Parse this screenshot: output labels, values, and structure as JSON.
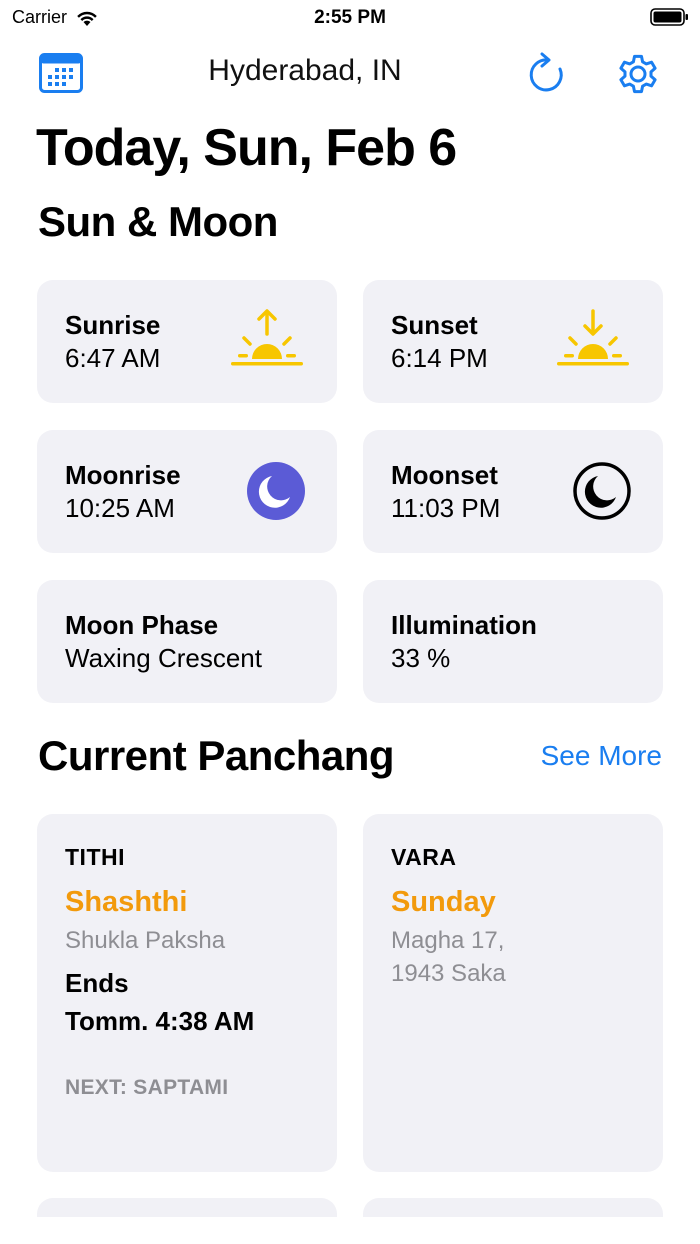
{
  "status_bar": {
    "carrier": "Carrier",
    "time": "2:55 PM"
  },
  "nav": {
    "location": "Hyderabad, IN",
    "calendar_icon": "calendar-icon",
    "refresh_icon": "refresh-icon",
    "settings_icon": "gear-icon",
    "accent_color": "#1a7ef0"
  },
  "header": {
    "title": "Today, Sun, Feb 6"
  },
  "sun_moon": {
    "title": "Sun & Moon",
    "cards": [
      {
        "label": "Sunrise",
        "value": "6:47 AM",
        "icon": "sunrise-icon"
      },
      {
        "label": "Sunset",
        "value": "6:14 PM",
        "icon": "sunset-icon"
      },
      {
        "label": "Moonrise",
        "value": "10:25 AM",
        "icon": "moonrise-icon"
      },
      {
        "label": "Moonset",
        "value": "11:03 PM",
        "icon": "moonset-icon"
      },
      {
        "label": "Moon Phase",
        "value": "Waxing Crescent"
      },
      {
        "label": "Illumination",
        "value": "33 %"
      }
    ]
  },
  "panchang": {
    "title": "Current Panchang",
    "see_more": "See More",
    "highlight_color": "#f29a0c",
    "tithi": {
      "header": "TITHI",
      "name": "Shashthi",
      "sub": "Shukla Paksha",
      "ends_label": "Ends",
      "ends_value": "Tomm. 4:38 AM",
      "next": "NEXT: SAPTAMI"
    },
    "vara": {
      "header": "VARA",
      "name": "Sunday",
      "sub_line1": "Magha 17,",
      "sub_line2": "1943 Saka"
    }
  }
}
